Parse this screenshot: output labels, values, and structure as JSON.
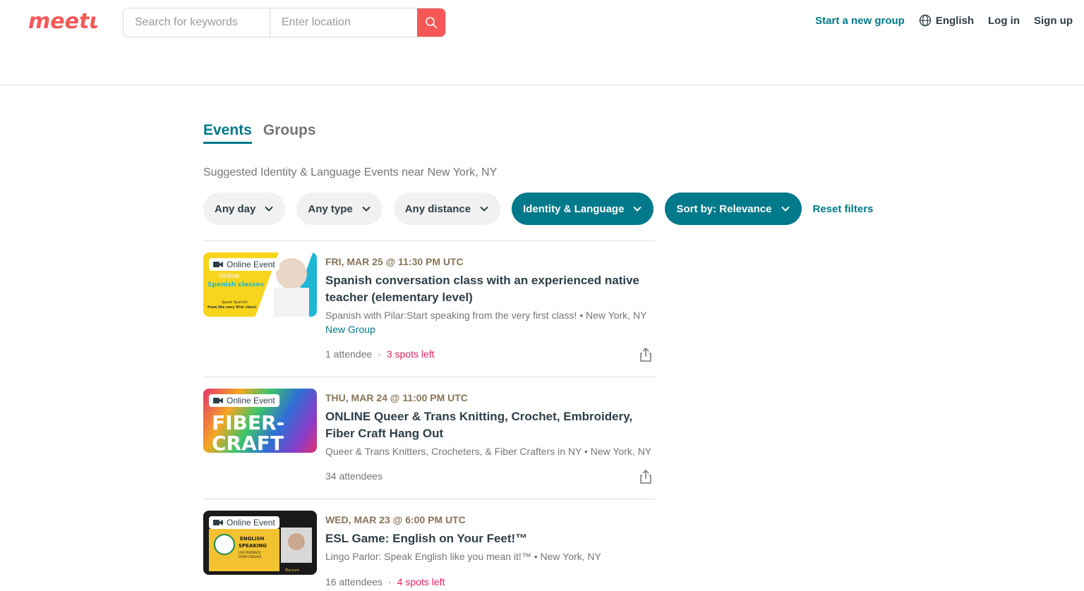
{
  "header": {
    "logo_text": "meetup",
    "search_placeholder": "Search for keywords",
    "location_placeholder": "Enter location",
    "nav": {
      "start_group": "Start a new group",
      "language": "English",
      "login": "Log in",
      "signup": "Sign up"
    }
  },
  "tabs": [
    {
      "label": "Events",
      "active": true
    },
    {
      "label": "Groups",
      "active": false
    }
  ],
  "suggest_text": "Suggested Identity & Language Events near New York, NY",
  "filters": [
    {
      "label": "Any day",
      "filled": false
    },
    {
      "label": "Any type",
      "filled": false
    },
    {
      "label": "Any distance",
      "filled": false
    },
    {
      "label": "Identity & Language",
      "filled": true
    },
    {
      "label": "Sort by: Relevance",
      "filled": true
    }
  ],
  "reset_label": "Reset filters",
  "online_badge": "Online Event",
  "events": [
    {
      "date": "FRI, MAR 25 @ 11:30 PM UTC",
      "title": "Spanish conversation class with an experienced native teacher (elementary level)",
      "group": "Spanish with Pilar:Start speaking from the very first class! • New York, NY",
      "tag": "New Group",
      "attendees": "1 attendee",
      "spots": "3 spots left",
      "thumb_lines": [
        "Online",
        "Spanish classes",
        "Speak Spanish",
        "from the very first class!"
      ]
    },
    {
      "date": "THU, MAR 24 @ 11:00 PM UTC",
      "title": "ONLINE Queer & Trans Knitting, Crochet, Embroidery, Fiber Craft Hang Out",
      "group": "Queer & Trans Knitters, Crocheters, & Fiber Crafters in NY • New York, NY",
      "tag": "",
      "attendees": "34 attendees",
      "spots": "",
      "thumb_lines": [
        "FIBER-",
        "CRAFT"
      ]
    },
    {
      "date": "WED, MAR 23 @ 6:00 PM UTC",
      "title": "ESL Game: English on Your Feet!™",
      "group": "Lingo Parlor: Speak English like you mean it!™ • New York, NY",
      "tag": "",
      "attendees": "16 attendees",
      "spots": "4 spots left",
      "thumb_lines": [
        "ENGLISH",
        "SPEAKING",
        "LIVE FEEDBACK",
        "FROM COACHES",
        "Maryam"
      ]
    }
  ],
  "colors": {
    "brand_red": "#f65858",
    "teal": "#00798a",
    "date_brown": "#877457",
    "spots_pink": "#e4205f"
  }
}
